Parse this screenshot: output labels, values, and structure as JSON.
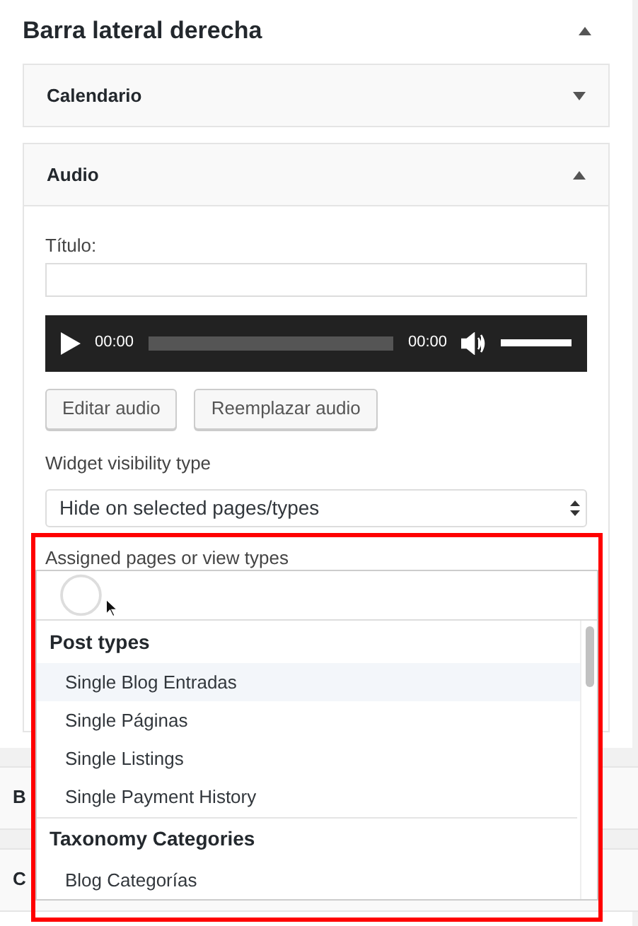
{
  "sidebar": {
    "title": "Barra lateral derecha",
    "expanded": true
  },
  "widgets": [
    {
      "kind": "collapsed",
      "title": "Calendario",
      "expanded": false
    },
    {
      "kind": "audio",
      "title": "Audio",
      "expanded": true,
      "title_field": {
        "label": "Título:"
      },
      "player": {
        "current": "00:00",
        "duration": "00:00",
        "volume": {
          "level": 1
        }
      },
      "buttons": [
        "Editar audio",
        "Reemplazar audio"
      ],
      "visibility": {
        "label": "Widget visibility type",
        "value": "Hide on selected pages/types"
      },
      "assigned_label": "Assigned pages or view types"
    },
    {
      "kind": "collapsed",
      "title": "B"
    },
    {
      "kind": "collapsed",
      "title": "C"
    }
  ],
  "dropdown": {
    "loading": true,
    "groups": [
      {
        "label": "Post types",
        "options": [
          {
            "label": "Single Blog Entradas",
            "highlighted": true
          },
          {
            "label": "Single Páginas",
            "highlighted": false
          },
          {
            "label": "Single Listings",
            "highlighted": false
          },
          {
            "label": "Single Payment History",
            "highlighted": false
          }
        ]
      },
      {
        "label": "Taxonomy Categories",
        "options": [
          {
            "label": "Blog Categorías",
            "highlighted": false
          }
        ]
      }
    ]
  }
}
